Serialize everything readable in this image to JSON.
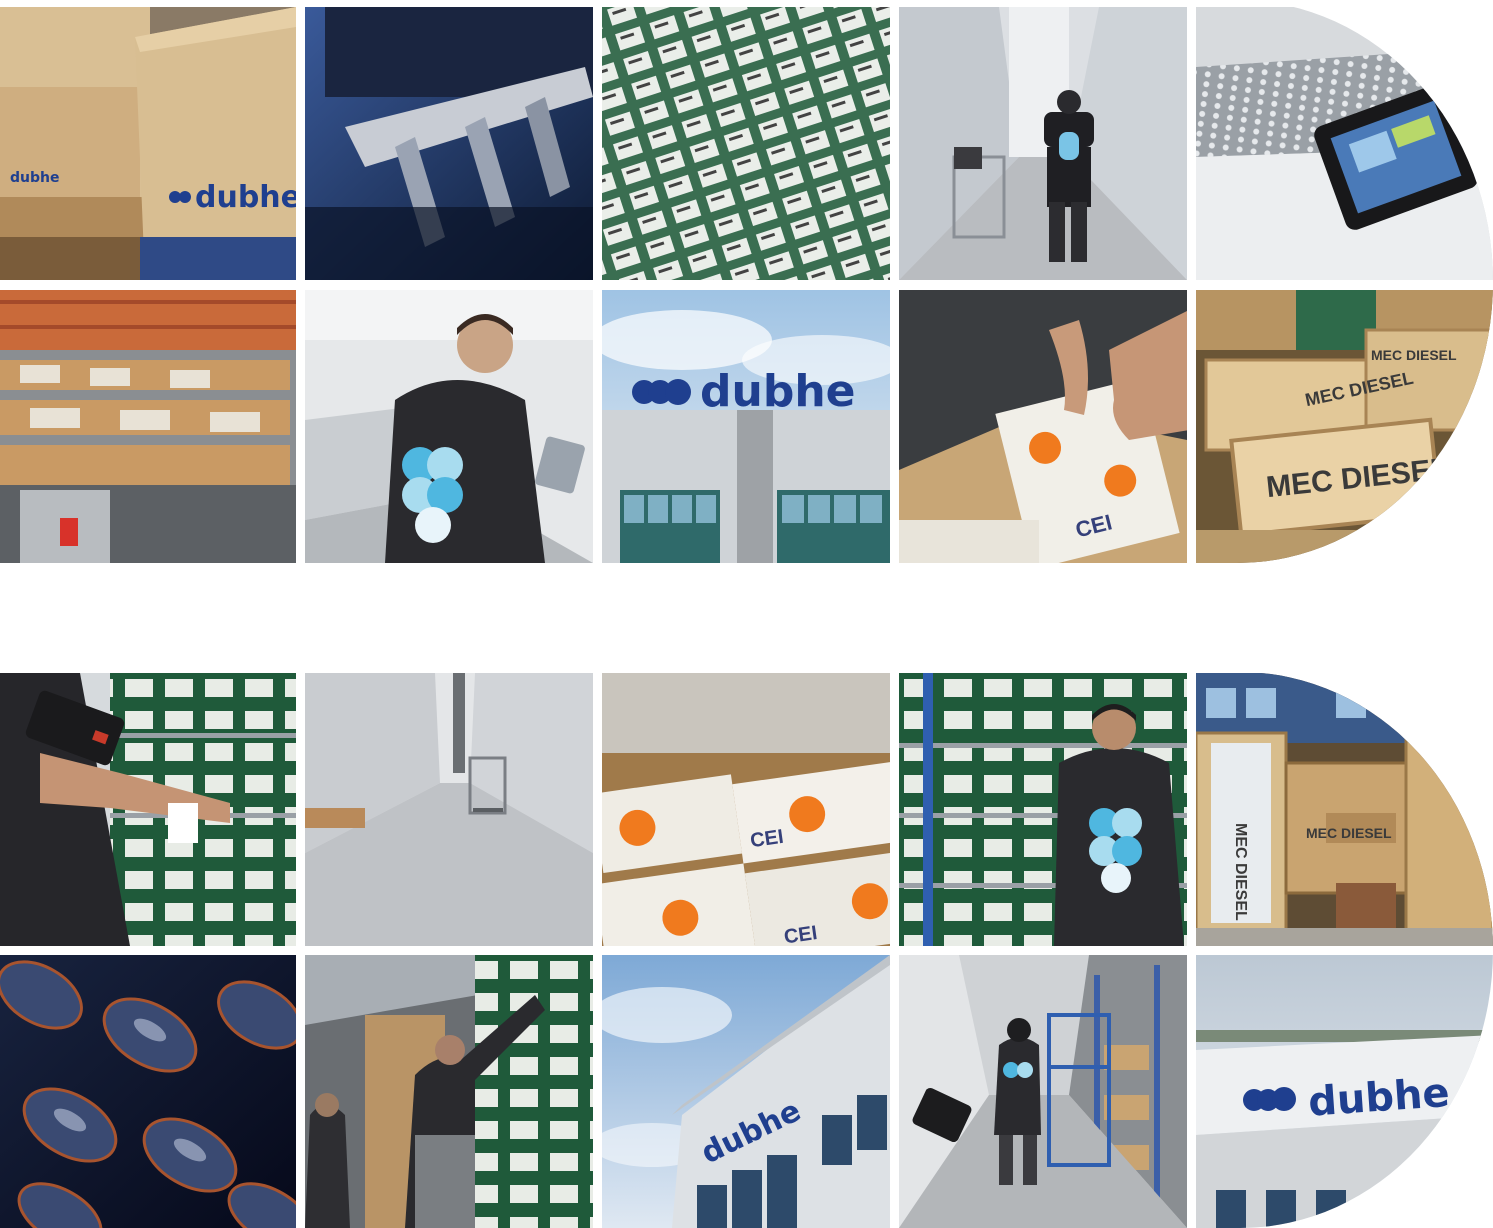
{
  "brand_name": "dubhe",
  "crate_label": "MEC DIESEL",
  "box_label": "CEI",
  "colors": {
    "brand_blue": "#1f3f8f",
    "logo_cyan": "#4fb7e0",
    "logo_light": "#a8dcef",
    "box_green": "#1f5a3a",
    "cei_orange": "#f07a1e",
    "jacket": "#2a2a2e"
  },
  "galleries": [
    {
      "tiles": [
        {
          "subject": "cardboard boxes with dubhe logo"
        },
        {
          "subject": "robotic gripper close-up"
        },
        {
          "subject": "rows of green part boxes"
        },
        {
          "subject": "worker walking in automated warehouse aisle"
        },
        {
          "subject": "conveyor with touch terminal"
        },
        {
          "subject": "warehouse shelving with boxes"
        },
        {
          "subject": "worker using terminal"
        },
        {
          "subject": "dubhe sign on building"
        },
        {
          "subject": "hands holding CEI box"
        },
        {
          "subject": "MEC DIESEL wooden crates"
        }
      ]
    },
    {
      "tiles": [
        {
          "subject": "worker scanning barcode on shelf"
        },
        {
          "subject": "automated storage aisle with cart"
        },
        {
          "subject": "CEI boxes in carton"
        },
        {
          "subject": "worker at shelves with green boxes"
        },
        {
          "subject": "MEC DIESEL crates in warehouse"
        },
        {
          "subject": "crankshafts close-up"
        },
        {
          "subject": "workers picking from tall shelves"
        },
        {
          "subject": "dubhe building facade"
        },
        {
          "subject": "worker pushing blue cart in aisle"
        },
        {
          "subject": "dubhe sign on rooftop"
        }
      ]
    }
  ]
}
